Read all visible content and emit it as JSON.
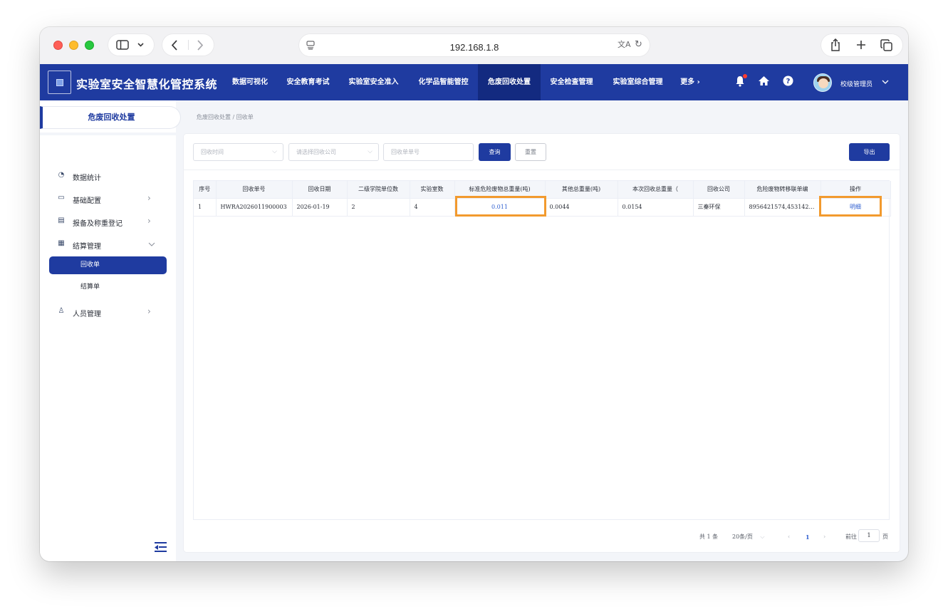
{
  "browser": {
    "url": "192.168.1.8"
  },
  "app": {
    "title": "实验室安全智慧化管控系统",
    "nav": [
      {
        "label": "数据可视化"
      },
      {
        "label": "安全教育考试"
      },
      {
        "label": "实验室安全准入"
      },
      {
        "label": "化学品智能管控"
      },
      {
        "label": "危废回收处置",
        "active": true
      },
      {
        "label": "安全检查管理"
      },
      {
        "label": "实验室综合管理"
      },
      {
        "label": "更多 ›"
      }
    ],
    "user_name": "校级管理员",
    "notification_dot": "#ff3b30",
    "brand_color": "#1f3ba0"
  },
  "sidebar": {
    "tab_label": "危废回收处置",
    "items": [
      {
        "label": "数据统计",
        "icon": "pie-chart-icon"
      },
      {
        "label": "基础配置",
        "icon": "monitor-icon"
      },
      {
        "label": "报备及称重登记",
        "icon": "document-icon"
      },
      {
        "label": "结算管理",
        "icon": "calculator-icon"
      },
      {
        "label": "人员管理",
        "icon": "user-icon"
      }
    ],
    "sub_items": [
      {
        "label": "回收单",
        "active": true
      },
      {
        "label": "结算单"
      }
    ]
  },
  "breadcrumb": "危废回收处置 / 回收单",
  "filters": {
    "time_placeholder": "回收时间",
    "company_placeholder": "请选择回收公司",
    "order_no_placeholder": "回收单单号",
    "query_label": "查询",
    "reset_label": "重置",
    "export_label": "导出"
  },
  "table": {
    "headers": [
      "序号",
      "回收单号",
      "回收日期",
      "二级学院单位数",
      "实验室数",
      "标准危险废物总重量(吨)",
      "其他总重量(吨)",
      "本次回收总重量（",
      "回收公司",
      "危险废物转移联单编",
      "操作"
    ],
    "rows": [
      [
        "1",
        "HWRA2026011900003",
        "2026-01-19",
        "2",
        "4",
        "0.011",
        "0.0044",
        "0.0154",
        "三秦环保",
        "8956421574,4531425...",
        "明细"
      ]
    ]
  },
  "pagination": {
    "total": "共 1 条",
    "page_size": "20条/页",
    "current_page": "1",
    "goto_label": "前往",
    "goto_value": "1",
    "page_suffix": "页"
  }
}
